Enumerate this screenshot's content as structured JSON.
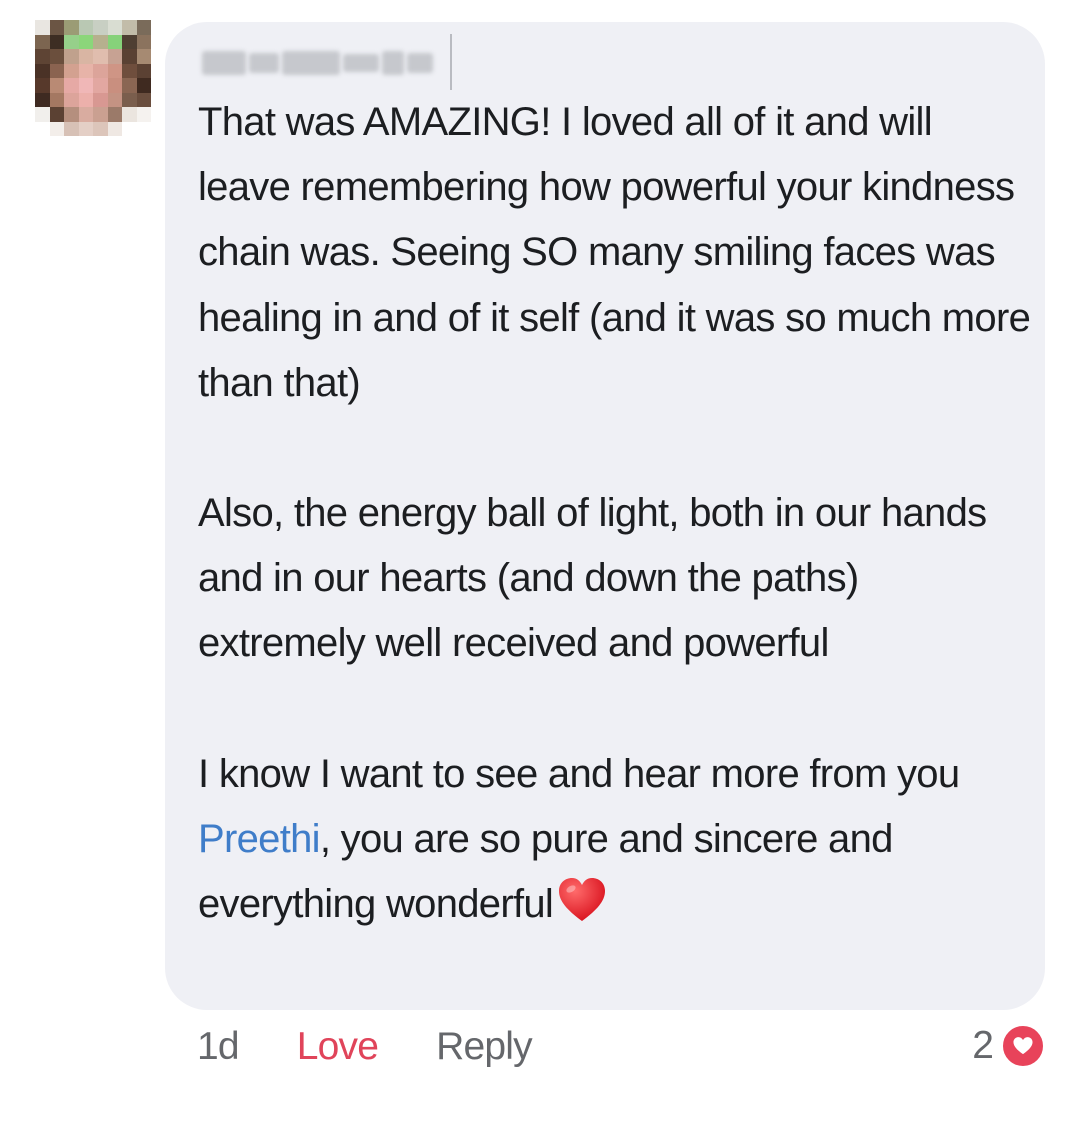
{
  "comment": {
    "author_avatar": "blurred-profile-photo",
    "author_name": "",
    "paragraphs": [
      "That was AMAZING!  I loved all of it and will leave remembering how powerful your kindness chain was.  Seeing SO many smiling faces was healing in and of it self (and it was so much more than that)",
      "Also, the energy ball of light, both in our hands and in our hearts (and down the paths) extremely well received and powerful"
    ],
    "last_paragraph": {
      "before_mention": "I know I want to see and hear more from you ",
      "mention": "Preethi",
      "after_mention": ",  you are so pure and sincere and everything wonderful",
      "emoji": "red-heart"
    }
  },
  "actions": {
    "time": "1d",
    "love_label": "Love",
    "reply_label": "Reply"
  },
  "reactions": {
    "count": "2",
    "type": "heart-icon",
    "color": "#e8435a"
  },
  "colors": {
    "bubble_bg": "#eff0f5",
    "text": "#1c1e21",
    "mention": "#3f7dc9",
    "love": "#e0445a",
    "muted": "#65676b"
  }
}
